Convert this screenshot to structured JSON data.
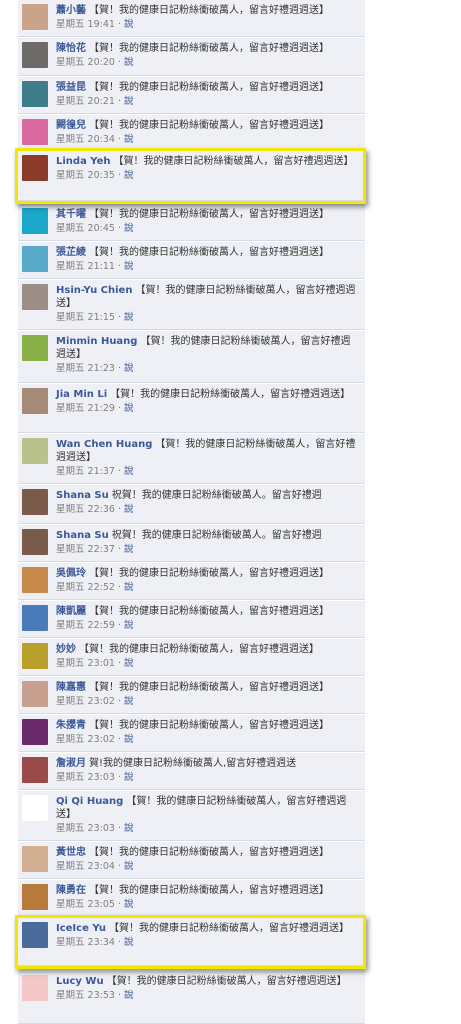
{
  "comments": [
    {
      "name": "蕭小藝",
      "message": "【賀！我的健康日記粉絲衝破萬人，留言好禮週週送】",
      "day": "星期五",
      "time": "19:41",
      "reply": "說",
      "avatar_color": "#c9a48a"
    },
    {
      "name": "陳怡花",
      "message": "【賀！我的健康日記粉絲衝破萬人，留言好禮週週送】",
      "day": "星期五",
      "time": "20:20",
      "reply": "說",
      "avatar_color": "#6d6a6a"
    },
    {
      "name": "張益昆",
      "message": "【賀！我的健康日記粉絲衝破萬人，留言好禮週週送】",
      "day": "星期五",
      "time": "20:21",
      "reply": "說",
      "avatar_color": "#3f7d8a"
    },
    {
      "name": "闕徨兒",
      "message": "【賀！我的健康日記粉絲衝破萬人，留言好禮週週送】",
      "day": "星期五",
      "time": "20:34",
      "reply": "說",
      "avatar_color": "#d86aa0"
    },
    {
      "name": "Linda Yeh",
      "message": "【賀！我的健康日記粉絲衝破萬人，留言好禮週週送】",
      "day": "星期五",
      "time": "20:35",
      "reply": "說",
      "avatar_color": "#8a3b2a"
    },
    {
      "name": "其千曜",
      "message": "【賀！我的健康日記粉絲衝破萬人，留言好禮週週送】",
      "day": "星期五",
      "time": "20:45",
      "reply": "說",
      "avatar_color": "#1aa7c9"
    },
    {
      "name": "張芷綾",
      "message": "【賀！我的健康日記粉絲衝破萬人，留言好禮週週送】",
      "day": "星期五",
      "time": "21:11",
      "reply": "說",
      "avatar_color": "#58a8c8"
    },
    {
      "name": "Hsin-Yu Chien",
      "message": "【賀！我的健康日記粉絲衝破萬人，留言好禮週週送】",
      "day": "星期五",
      "time": "21:15",
      "reply": "說",
      "avatar_color": "#9a8e86"
    },
    {
      "name": "Minmin Huang",
      "message": "【賀！我的健康日記粉絲衝破萬人，留言好禮週週送】",
      "day": "星期五",
      "time": "21:23",
      "reply": "說",
      "avatar_color": "#8ab04a"
    },
    {
      "name": "Jia Min Li",
      "message": "【賀！我的健康日記粉絲衝破萬人，留言好禮週週送】",
      "day": "星期五",
      "time": "21:29",
      "reply": "說",
      "avatar_color": "#a58a78"
    },
    {
      "name": "Wan Chen Huang",
      "message": "【賀！我的健康日記粉絲衝破萬人，留言好禮週週送】",
      "day": "星期五",
      "time": "21:37",
      "reply": "說",
      "avatar_color": "#b9c28a"
    },
    {
      "name": "Shana Su",
      "message": "祝賀！我的健康日記粉絲衝破萬人。留言好禮週",
      "day": "星期五",
      "time": "22:36",
      "reply": "說",
      "avatar_color": "#7a5a4a"
    },
    {
      "name": "Shana Su",
      "message": "祝賀！我的健康日記粉絲衝破萬人。留言好禮週",
      "day": "星期五",
      "time": "22:37",
      "reply": "說",
      "avatar_color": "#7a5a4a"
    },
    {
      "name": "吳佩玲",
      "message": "【賀！我的健康日記粉絲衝破萬人，留言好禮週週送】",
      "day": "星期五",
      "time": "22:52",
      "reply": "說",
      "avatar_color": "#c58a4a"
    },
    {
      "name": "陳凱麗",
      "message": "【賀！我的健康日記粉絲衝破萬人，留言好禮週週送】",
      "day": "星期五",
      "time": "22:59",
      "reply": "說",
      "avatar_color": "#4a7ab8"
    },
    {
      "name": "妙妙",
      "message": "【賀！我的健康日記粉絲衝破萬人，留言好禮週週送】",
      "day": "星期五",
      "time": "23:01",
      "reply": "說",
      "avatar_color": "#b8a02a"
    },
    {
      "name": "陳嘉惠",
      "message": "【賀！我的健康日記粉絲衝破萬人，留言好禮週週送】",
      "day": "星期五",
      "time": "23:02",
      "reply": "說",
      "avatar_color": "#c8a090"
    },
    {
      "name": "朱攖青",
      "message": "【賀！我的健康日記粉絲衝破萬人，留言好禮週週送】",
      "day": "星期五",
      "time": "23:02",
      "reply": "說",
      "avatar_color": "#6a2a6a"
    },
    {
      "name": "詹淑月",
      "message": "賀!我的健康日記粉絲衝破萬人,留言好禮週週送",
      "day": "星期五",
      "time": "23:03",
      "reply": "說",
      "avatar_color": "#9a4a4a"
    },
    {
      "name": "Qi Qi Huang",
      "message": "【賀！我的健康日記粉絲衝破萬人，留言好禮週週送】",
      "day": "星期五",
      "time": "23:03",
      "reply": "說",
      "avatar_color": "#ffffff"
    },
    {
      "name": "黃世忠",
      "message": "【賀！我的健康日記粉絲衝破萬人，留言好禮週週送】",
      "day": "星期五",
      "time": "23:04",
      "reply": "說",
      "avatar_color": "#d0b090"
    },
    {
      "name": "陳勇在",
      "message": "【賀！我的健康日記粉絲衝破萬人，留言好禮週週送】",
      "day": "星期五",
      "time": "23:05",
      "reply": "說",
      "avatar_color": "#b87a3a"
    },
    {
      "name": "IceIce Yu",
      "message": "【賀！我的健康日記粉絲衝破萬人，留言好禮週週送】",
      "day": "星期五",
      "time": "23:34",
      "reply": "說",
      "avatar_color": "#4a6a9a"
    },
    {
      "name": "Lucy Wu",
      "message": "【賀！我的健康日記粉絲衝破萬人，留言好禮週週送】",
      "day": "星期五",
      "time": "23:53",
      "reply": "說",
      "avatar_color": "#f4c8c8"
    }
  ],
  "highlighted": [
    4,
    22
  ]
}
